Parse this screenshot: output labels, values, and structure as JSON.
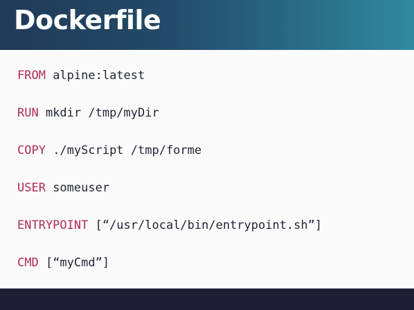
{
  "slide": {
    "title": "Dockerfile"
  },
  "code": {
    "lines": [
      {
        "keyword": "FROM",
        "argument": " alpine:latest"
      },
      {
        "keyword": "RUN",
        "argument": " mkdir /tmp/myDir"
      },
      {
        "keyword": "COPY",
        "argument": " ./myScript /tmp/forme"
      },
      {
        "keyword": "USER",
        "argument": " someuser"
      },
      {
        "keyword": "ENTRYPOINT",
        "argument": " [“/usr/local/bin/entrypoint.sh”]"
      },
      {
        "keyword": "CMD",
        "argument": " [“myCmd”]"
      }
    ]
  },
  "colors": {
    "header_gradient_start": "#1f3a57",
    "header_gradient_end": "#2f8aa0",
    "keyword": "#b22a5c",
    "code_text": "#1e2430",
    "footer": "#1e1f33"
  }
}
